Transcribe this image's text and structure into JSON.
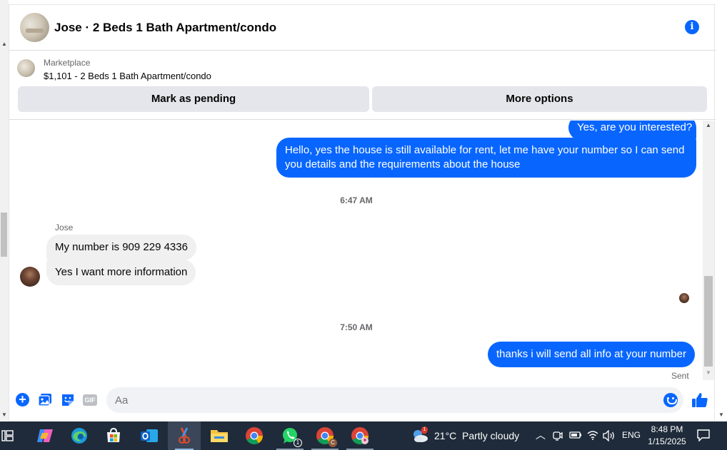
{
  "header": {
    "title": "Jose · 2 Beds 1 Bath Apartment/condo"
  },
  "listing": {
    "source": "Marketplace",
    "title": "$1,101 - 2 Beds 1 Bath Apartment/condo",
    "mark_pending_label": "Mark as pending",
    "more_options_label": "More options"
  },
  "messages": {
    "out_1": "Yes, are you interested?",
    "out_2": "Hello, yes the house is still available for rent, let me have your number so I can send you details and the requirements about the house",
    "timestamp_1": "6:47 AM",
    "sender_name": "Jose",
    "in_1": "My number is 909 229 4336",
    "in_2": "Yes I want more information",
    "timestamp_2": "7:50 AM",
    "out_3": "thanks i will send all info at your number",
    "status": "Sent"
  },
  "composer": {
    "placeholder": "Aa",
    "gif_label": "GIF"
  },
  "taskbar": {
    "whatsapp_badge": "1",
    "weather_badge": "1",
    "temperature": "21°C",
    "condition": "Partly cloudy",
    "language": "ENG",
    "time": "8:48 PM",
    "date": "1/15/2025",
    "chrome_profile_letter": "C"
  },
  "colors": {
    "messenger_blue": "#0866ff",
    "incoming_bubble": "#f0f0f0",
    "taskbar_bg": "#1f2b3a"
  }
}
